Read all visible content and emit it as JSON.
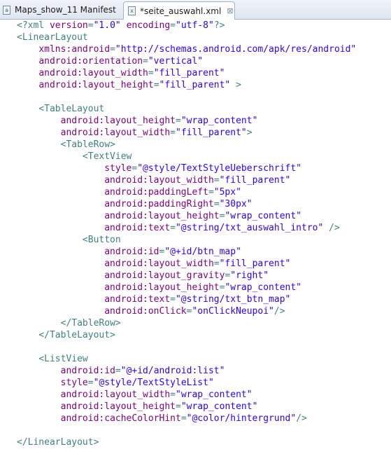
{
  "tabs": [
    {
      "label": "Maps_show_11 Manifest",
      "icon": "android-manifest-icon",
      "active": false
    },
    {
      "label": "*seite_auswahl.xml",
      "icon": "xml-file-icon",
      "active": true,
      "close": "⊠"
    }
  ],
  "editor": {
    "lines": [
      {
        "indent": "",
        "tokens": [
          [
            "decl",
            "<?xml "
          ],
          [
            "attr",
            "version"
          ],
          [
            "decl",
            "="
          ],
          [
            "val",
            "\"1.0\""
          ],
          [
            "decl",
            " "
          ],
          [
            "attr",
            "encoding"
          ],
          [
            "decl",
            "="
          ],
          [
            "val",
            "\"utf-8\""
          ],
          [
            "decl",
            "?>"
          ]
        ]
      },
      {
        "indent": "",
        "tokens": [
          [
            "tag",
            "<LinearLayout"
          ]
        ]
      },
      {
        "indent": "    ",
        "tokens": [
          [
            "attr",
            "xmlns:android"
          ],
          [
            "tag",
            "="
          ],
          [
            "val",
            "\"http://schemas.android.com/apk/res/android\""
          ]
        ]
      },
      {
        "indent": "    ",
        "tokens": [
          [
            "attr",
            "android:orientation"
          ],
          [
            "tag",
            "="
          ],
          [
            "val",
            "\"vertical\""
          ]
        ]
      },
      {
        "indent": "    ",
        "tokens": [
          [
            "attr",
            "android:layout_width"
          ],
          [
            "tag",
            "="
          ],
          [
            "val",
            "\"fill_parent\""
          ]
        ]
      },
      {
        "indent": "    ",
        "tokens": [
          [
            "attr",
            "android:layout_height"
          ],
          [
            "tag",
            "="
          ],
          [
            "val",
            "\"fill_parent\""
          ],
          [
            "tag",
            " >"
          ]
        ]
      },
      {
        "indent": "",
        "tokens": []
      },
      {
        "indent": "    ",
        "tokens": [
          [
            "tag",
            "<TableLayout"
          ]
        ]
      },
      {
        "indent": "        ",
        "tokens": [
          [
            "attr",
            "android:layout_height"
          ],
          [
            "tag",
            "="
          ],
          [
            "val",
            "\"wrap_content\""
          ]
        ]
      },
      {
        "indent": "        ",
        "tokens": [
          [
            "attr",
            "android:layout_width"
          ],
          [
            "tag",
            "="
          ],
          [
            "val",
            "\"fill_parent\""
          ],
          [
            "tag",
            ">"
          ]
        ]
      },
      {
        "indent": "        ",
        "tokens": [
          [
            "tag",
            "<TableRow>"
          ]
        ]
      },
      {
        "indent": "            ",
        "tokens": [
          [
            "tag",
            "<TextView"
          ]
        ]
      },
      {
        "indent": "                ",
        "tokens": [
          [
            "attr",
            "style"
          ],
          [
            "tag",
            "="
          ],
          [
            "val",
            "\"@style/TextStyleUeberschrift\""
          ]
        ]
      },
      {
        "indent": "                ",
        "tokens": [
          [
            "attr",
            "android:layout_width"
          ],
          [
            "tag",
            "="
          ],
          [
            "val",
            "\"fill_parent\""
          ]
        ]
      },
      {
        "indent": "                ",
        "tokens": [
          [
            "attr",
            "android:paddingLeft"
          ],
          [
            "tag",
            "="
          ],
          [
            "val",
            "\"5px\""
          ]
        ]
      },
      {
        "indent": "                ",
        "tokens": [
          [
            "attr",
            "android:paddingRight"
          ],
          [
            "tag",
            "="
          ],
          [
            "val",
            "\"30px\""
          ]
        ]
      },
      {
        "indent": "                ",
        "tokens": [
          [
            "attr",
            "android:layout_height"
          ],
          [
            "tag",
            "="
          ],
          [
            "val",
            "\"wrap_content\""
          ]
        ]
      },
      {
        "indent": "                ",
        "tokens": [
          [
            "attr",
            "android:text"
          ],
          [
            "tag",
            "="
          ],
          [
            "val",
            "\"@string/txt_auswahl_intro\""
          ],
          [
            "tag",
            " />"
          ]
        ]
      },
      {
        "indent": "            ",
        "tokens": [
          [
            "tag",
            "<Button"
          ]
        ]
      },
      {
        "indent": "                ",
        "tokens": [
          [
            "attr",
            "android:id"
          ],
          [
            "tag",
            "="
          ],
          [
            "val",
            "\"@+id/btn_map\""
          ]
        ]
      },
      {
        "indent": "                ",
        "tokens": [
          [
            "attr",
            "android:layout_width"
          ],
          [
            "tag",
            "="
          ],
          [
            "val",
            "\"fill_parent\""
          ]
        ]
      },
      {
        "indent": "                ",
        "tokens": [
          [
            "attr",
            "android:layout_gravity"
          ],
          [
            "tag",
            "="
          ],
          [
            "val",
            "\"right\""
          ]
        ]
      },
      {
        "indent": "                ",
        "tokens": [
          [
            "attr",
            "android:layout_height"
          ],
          [
            "tag",
            "="
          ],
          [
            "val",
            "\"wrap_content\""
          ]
        ]
      },
      {
        "indent": "                ",
        "tokens": [
          [
            "attr",
            "android:text"
          ],
          [
            "tag",
            "="
          ],
          [
            "val",
            "\"@string/txt_btn_map\""
          ]
        ]
      },
      {
        "indent": "                ",
        "tokens": [
          [
            "attr",
            "android:onClick"
          ],
          [
            "tag",
            "="
          ],
          [
            "val",
            "\"onClickNeupoi\""
          ],
          [
            "tag",
            "/>"
          ]
        ]
      },
      {
        "indent": "        ",
        "tokens": [
          [
            "tag",
            "</TableRow>"
          ]
        ]
      },
      {
        "indent": "    ",
        "tokens": [
          [
            "tag",
            "</TableLayout>"
          ]
        ]
      },
      {
        "indent": "",
        "tokens": []
      },
      {
        "indent": "    ",
        "tokens": [
          [
            "tag",
            "<ListView"
          ]
        ]
      },
      {
        "indent": "        ",
        "tokens": [
          [
            "attr",
            "android:id"
          ],
          [
            "tag",
            "="
          ],
          [
            "val",
            "\"@+id/android:list\""
          ]
        ]
      },
      {
        "indent": "        ",
        "tokens": [
          [
            "attr",
            "style"
          ],
          [
            "tag",
            "="
          ],
          [
            "val",
            "\"@style/TextStyleList\""
          ]
        ]
      },
      {
        "indent": "        ",
        "tokens": [
          [
            "attr",
            "android:layout_width"
          ],
          [
            "tag",
            "="
          ],
          [
            "val",
            "\"wrap_content\""
          ]
        ]
      },
      {
        "indent": "        ",
        "tokens": [
          [
            "attr",
            "android:layout_height"
          ],
          [
            "tag",
            "="
          ],
          [
            "val",
            "\"wrap_content\""
          ]
        ]
      },
      {
        "indent": "        ",
        "tokens": [
          [
            "attr",
            "android:cacheColorHint"
          ],
          [
            "tag",
            "="
          ],
          [
            "val",
            "\"@color/hintergrund\""
          ],
          [
            "tag",
            "/>"
          ]
        ]
      },
      {
        "indent": "",
        "tokens": []
      },
      {
        "indent": "",
        "tokens": [
          [
            "tag",
            "</LinearLayout>"
          ]
        ]
      }
    ]
  }
}
